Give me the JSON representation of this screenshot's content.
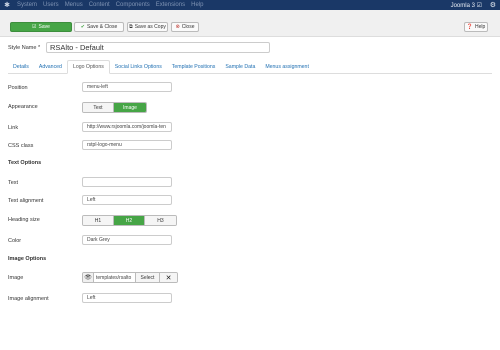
{
  "topnav": {
    "menu": [
      "System",
      "Users",
      "Menus",
      "Content",
      "Components",
      "Extensions",
      "Help"
    ],
    "brand": "Joomla 3 ☑"
  },
  "toolbar": {
    "save_label": "Save",
    "save_close_label": "Save & Close",
    "save_copy_label": "Save as Copy",
    "close_label": "Close",
    "help_label": "Help"
  },
  "style_name": {
    "label": "Style Name *",
    "value": "RSAlto - Default"
  },
  "tabs": [
    "Details",
    "Advanced",
    "Logo Options",
    "Social Links Options",
    "Template Positions",
    "Sample Data",
    "Menus assignment"
  ],
  "active_tab": "Logo Options",
  "fields": {
    "position": {
      "label": "Position",
      "value": "menu-left"
    },
    "appearance": {
      "label": "Appearance",
      "options": [
        "Text",
        "Image"
      ],
      "selected": "Image"
    },
    "link": {
      "label": "Link",
      "value": "http://www.rsjoomla.com/joomla-ten"
    },
    "css_class": {
      "label": "CSS class",
      "value": "rstpl-logo-menu"
    }
  },
  "text_options": {
    "section": "Text Options",
    "text": {
      "label": "Text",
      "value": ""
    },
    "text_alignment": {
      "label": "Text alignment",
      "value": "Left"
    },
    "heading_size": {
      "label": "Heading size",
      "options": [
        "H1",
        "H2",
        "H3"
      ],
      "selected": "H2"
    },
    "color": {
      "label": "Color",
      "value": "Dark Grey"
    }
  },
  "image_options": {
    "section": "Image Options",
    "image": {
      "label": "Image",
      "value": "templates/rsalto",
      "select_label": "Select"
    },
    "image_alignment": {
      "label": "Image alignment",
      "value": "Left"
    }
  },
  "colors": {
    "navbar": "#1a3867",
    "success": "#46a546",
    "link": "#1f6fb2",
    "danger": "#bd362f"
  }
}
